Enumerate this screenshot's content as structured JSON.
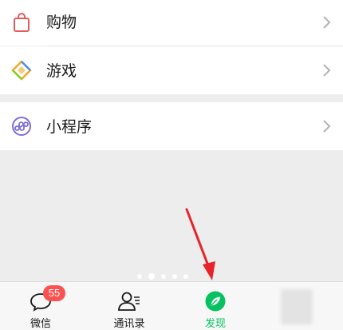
{
  "menu": {
    "items": [
      {
        "label": "购物",
        "icon": "shopping-bag-icon"
      },
      {
        "label": "游戏",
        "icon": "game-diamond-icon"
      },
      {
        "label": "小程序",
        "icon": "mini-program-icon"
      }
    ]
  },
  "tabbar": {
    "tabs": [
      {
        "label": "微信",
        "icon": "chat-bubble-icon",
        "badge": "55"
      },
      {
        "label": "通讯录",
        "icon": "contacts-icon"
      },
      {
        "label": "发现",
        "icon": "compass-icon",
        "active": true
      }
    ]
  },
  "colors": {
    "accent": "#07c160",
    "badge": "#fa5151",
    "annotation_arrow": "#e8232a"
  }
}
